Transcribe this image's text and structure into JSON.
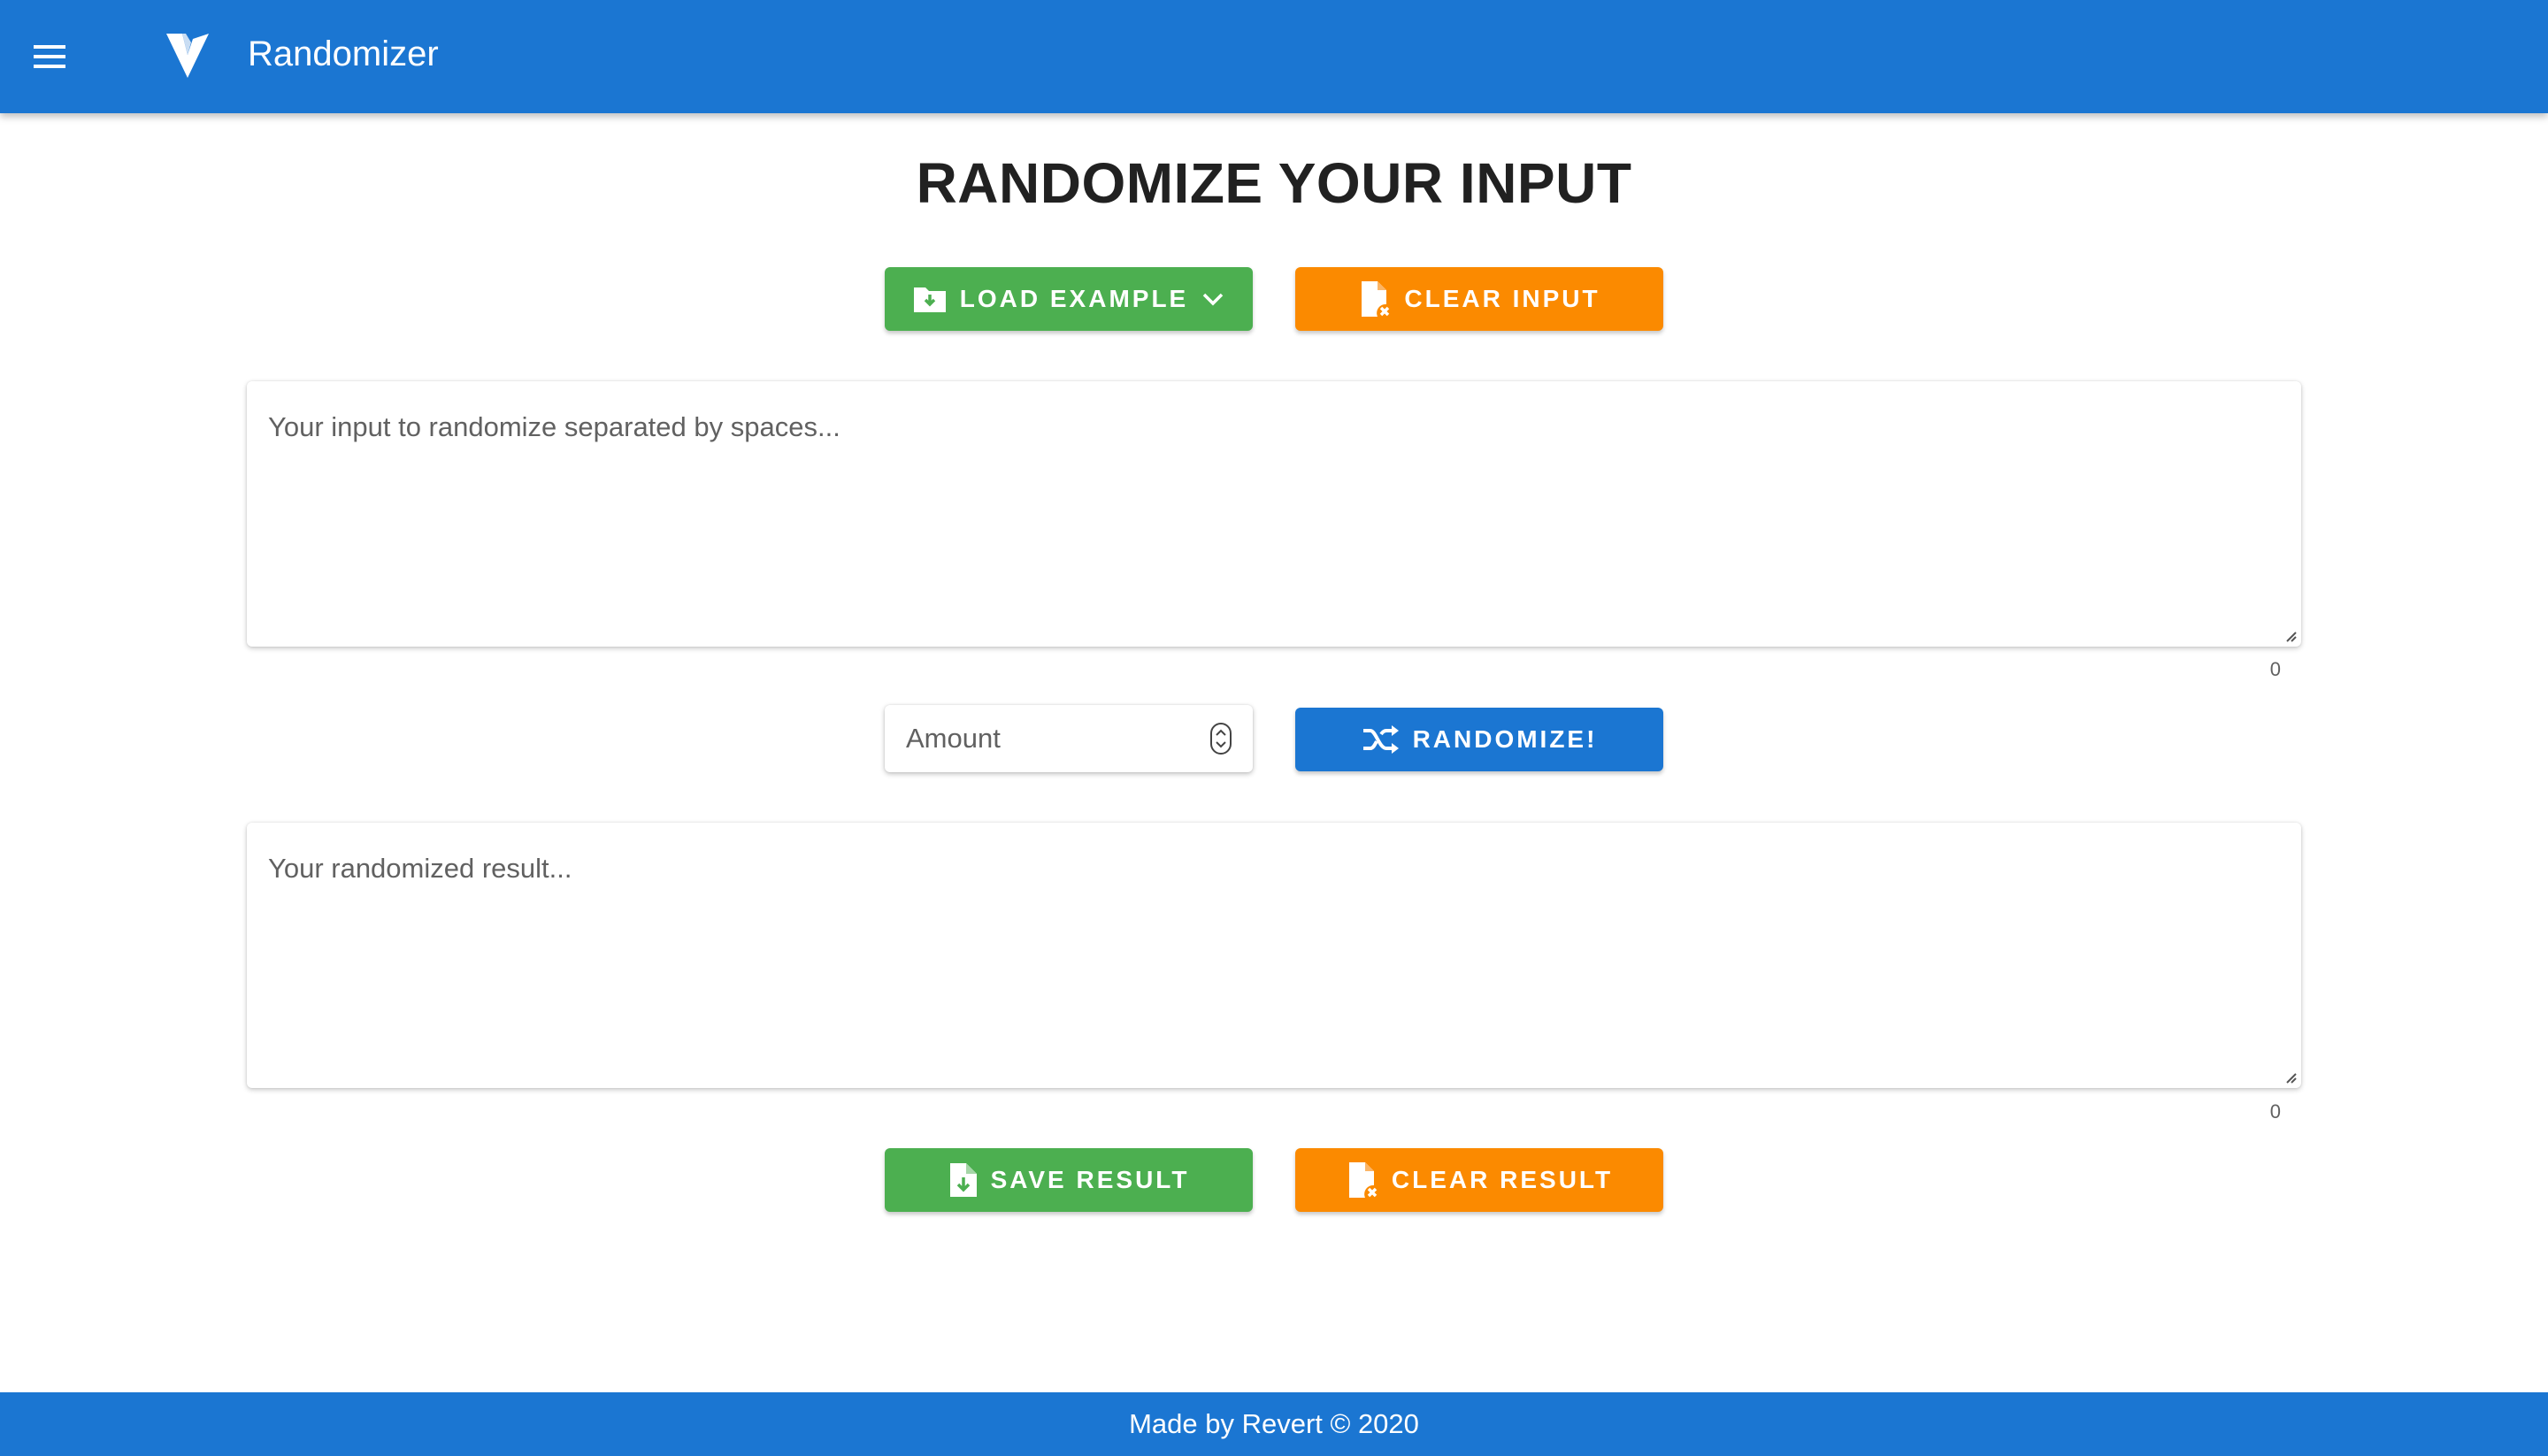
{
  "app": {
    "title": "Randomizer"
  },
  "page": {
    "heading": "RANDOMIZE YOUR INPUT"
  },
  "buttons": {
    "load_example": "LOAD EXAMPLE",
    "clear_input": "CLEAR INPUT",
    "randomize": "RANDOMIZE!",
    "save_result": "SAVE RESULT",
    "clear_result": "CLEAR RESULT"
  },
  "input": {
    "placeholder": "Your input to randomize separated by spaces...",
    "value": "",
    "counter": "0"
  },
  "amount": {
    "placeholder": "Amount",
    "value": ""
  },
  "result": {
    "placeholder": "Your randomized result...",
    "value": "",
    "counter": "0"
  },
  "footer": {
    "text": "Made by Revert © 2020"
  },
  "colors": {
    "primary": "#1b76d2",
    "success": "#4caf50",
    "warning": "#fb8a00"
  },
  "icons": {
    "menu": "menu-icon",
    "logo": "vuetify-logo-icon",
    "load_example": "folder-download-icon",
    "dropdown": "chevron-down-icon",
    "clear": "file-remove-icon",
    "randomize": "shuffle-icon",
    "save": "file-download-icon"
  }
}
